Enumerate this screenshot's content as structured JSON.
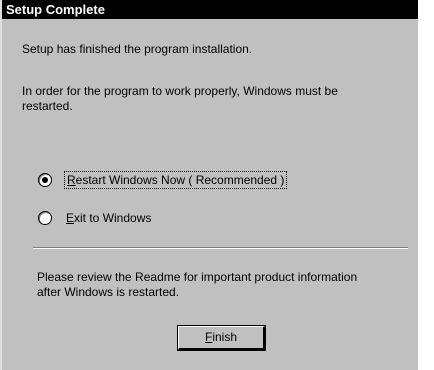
{
  "window": {
    "title": "Setup Complete"
  },
  "message": {
    "line1": "Setup has finished the program installation.",
    "line2a": "In order for the program to work properly, Windows must be",
    "line2b": "restarted."
  },
  "options": {
    "restart": {
      "hotkey": "R",
      "rest": "estart Windows Now ( Recommended )",
      "selected": true
    },
    "exit": {
      "hotkey": "E",
      "rest": "xit to Windows",
      "selected": false
    }
  },
  "note": {
    "line1": "Please review the Readme for important product information",
    "line2": "after Windows is restarted."
  },
  "finish_button": {
    "hotkey": "F",
    "rest": "inish"
  }
}
